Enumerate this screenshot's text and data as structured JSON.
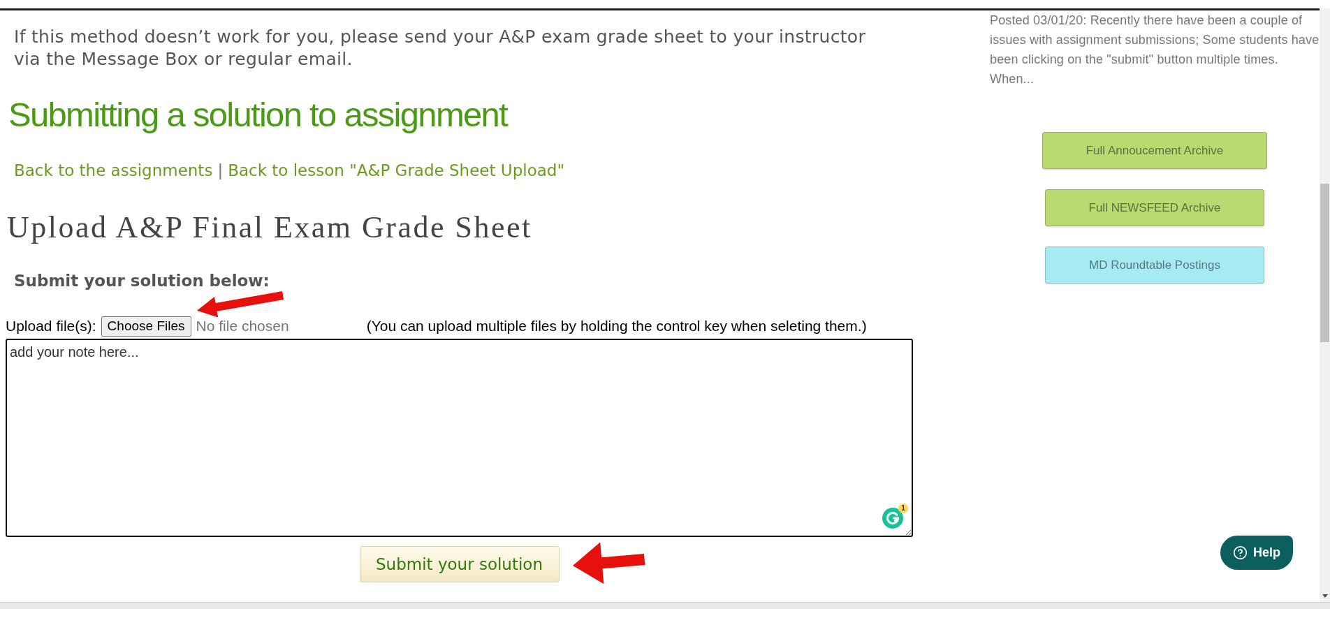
{
  "intro": {
    "text": "If this method doesn’t work for you, please send your A&P exam grade sheet to your instructor via the Message Box or regular email."
  },
  "page_title": "Submitting a solution to assignment",
  "breadcrumbs": {
    "links": [
      "Back to the assignments",
      "Back to lesson \"A&P Grade Sheet Upload\""
    ],
    "separator": "|"
  },
  "assignment_title": "Upload A&P Final Exam Grade Sheet",
  "form": {
    "heading": "Submit your solution below:",
    "upload": {
      "label": "Upload file(s):",
      "button": "Choose Files",
      "status": "No file chosen",
      "hint": "(You can upload multiple files by holding the control key when seleting them.)"
    },
    "note": {
      "value": "add your note here...",
      "assistant_count": "1"
    },
    "submit": "Submit your solution"
  },
  "sidebar": {
    "announcement": "Posted 03/01/20: Recently there have been a couple of issues with assignment submissions; Some students have been clicking on the \"submit\" button multiple times. When...",
    "buttons": [
      {
        "label": "Full Annoucement Archive",
        "color": "#b9d971"
      },
      {
        "label": "Full NEWSFEED Archive",
        "color": "#b9d971"
      },
      {
        "label": "MD Roundtable Postings",
        "color": "#a6ebf3"
      }
    ]
  },
  "help_button": {
    "label": "Help"
  }
}
